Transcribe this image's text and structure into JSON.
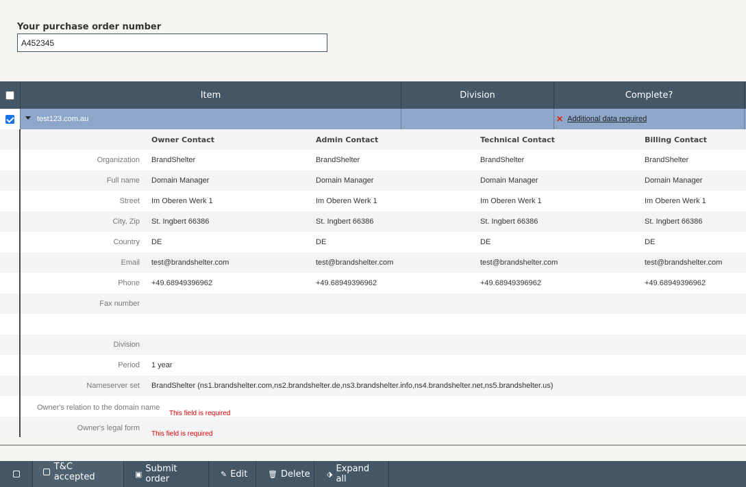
{
  "purchase_order": {
    "label": "Your purchase order number",
    "value": "A452345"
  },
  "table": {
    "headers": {
      "item": "Item",
      "division": "Division",
      "complete": "Complete?"
    }
  },
  "domain": {
    "name": "test123.com.au",
    "status": "Additional data required"
  },
  "contacts": {
    "headers": [
      "Owner Contact",
      "Admin Contact",
      "Technical Contact",
      "Billing Contact"
    ],
    "rows": [
      {
        "label": "Organization",
        "values": [
          "BrandShelter",
          "BrandShelter",
          "BrandShelter",
          "BrandShelter"
        ]
      },
      {
        "label": "Full name",
        "values": [
          "Domain Manager",
          "Domain Manager",
          "Domain Manager",
          "Domain Manager"
        ]
      },
      {
        "label": "Street",
        "values": [
          "Im Oberen Werk 1",
          "Im Oberen Werk 1",
          "Im Oberen Werk 1",
          "Im Oberen Werk 1"
        ]
      },
      {
        "label": "City, Zip",
        "values": [
          "St. Ingbert 66386",
          "St. Ingbert 66386",
          "St. Ingbert 66386",
          "St. Ingbert 66386"
        ]
      },
      {
        "label": "Country",
        "values": [
          "DE",
          "DE",
          "DE",
          "DE"
        ]
      },
      {
        "label": "Email",
        "values": [
          "test@brandshelter.com",
          "test@brandshelter.com",
          "test@brandshelter.com",
          "test@brandshelter.com"
        ]
      },
      {
        "label": "Phone",
        "values": [
          "+49.68949396962",
          "+49.68949396962",
          "+49.68949396962",
          "+49.68949396962"
        ]
      },
      {
        "label": "Fax number",
        "values": [
          "",
          "",
          "",
          ""
        ]
      }
    ]
  },
  "details": {
    "division_label": "Division",
    "period_label": "Period",
    "period_value": "1 year",
    "nameserver_label": "Nameserver set",
    "nameserver_value": "BrandShelter (ns1.brandshelter.com,ns2.brandshelter.de,ns3.brandshelter.info,ns4.brandshelter.net,ns5.brandshelter.us)",
    "relation_label": "Owner's relation to the domain name",
    "relation_error": "This field is required",
    "legal_form_label": "Owner's legal form",
    "legal_form_error": "This field is required"
  },
  "footer": {
    "tc_label": "T&C accepted",
    "submit_label": "Submit order",
    "edit_label": "Edit",
    "delete_label": "Delete",
    "expand_label": "Expand all"
  }
}
